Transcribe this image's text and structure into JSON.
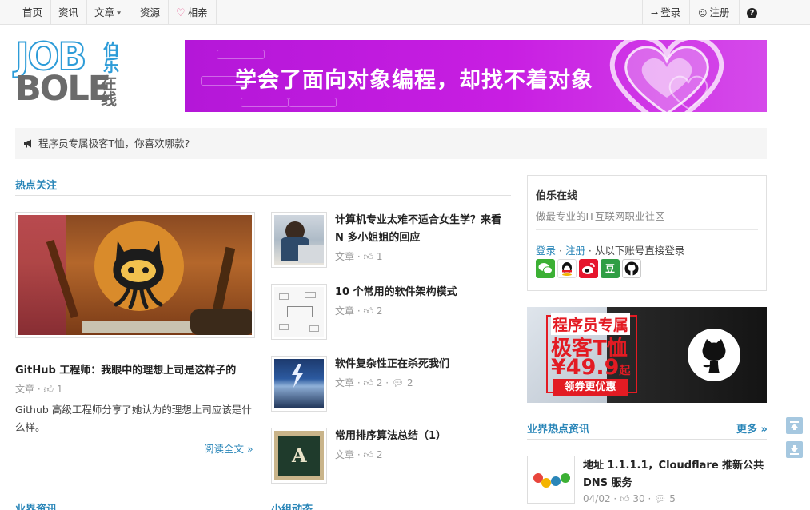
{
  "nav": {
    "items": [
      {
        "label": "首页"
      },
      {
        "label": "资讯"
      },
      {
        "label": "文章"
      },
      {
        "label": "资源"
      },
      {
        "label": "相亲"
      }
    ],
    "login": "登录",
    "register": "注册"
  },
  "logo": {
    "line1": "JOB",
    "line2": "BOLE",
    "cn1": "伯乐",
    "cn2": "在线"
  },
  "banner": {
    "text": "学会了面向对象编程，却找不着对象"
  },
  "notice": {
    "text": "程序员专属极客T恤，你喜欢哪款?"
  },
  "hot": {
    "title": "热点关注",
    "feature": {
      "title": "GitHub 工程师：我眼中的理想上司是这样子的",
      "meta": "文章 · ",
      "likes": "1",
      "desc": "Github 高级工程师分享了她认为的理想上司应该是什么样。",
      "read_more": "阅读全文 »"
    },
    "articles": [
      {
        "title": "计算机专业太难不适合女生学？来看 N 多小姐姐的回应",
        "meta": "文章 · ",
        "likes": "1",
        "comments": ""
      },
      {
        "title": "10 个常用的软件架构模式",
        "meta": "文章 · ",
        "likes": "2",
        "comments": ""
      },
      {
        "title": "软件复杂性正在杀死我们",
        "meta": "文章 · ",
        "likes": "2",
        "comments": "2"
      },
      {
        "title": "常用排序算法总结（1）",
        "meta": "文章 · ",
        "likes": "2",
        "comments": ""
      }
    ]
  },
  "sections": {
    "industry": "业界资讯",
    "group": "小组动态"
  },
  "sidebar": {
    "title": "伯乐在线",
    "subtitle": "做最专业的IT互联网职业社区",
    "login": "登录",
    "register": "注册",
    "login_sep": " · ",
    "login_suffix": " · 从以下账号直接登录"
  },
  "ad2": {
    "line1": "程序员专属",
    "line2": "极客T恤",
    "price": "¥49.9",
    "price_suffix": "起",
    "button": "领券更优惠"
  },
  "hot_news": {
    "title": "业界热点资讯",
    "more": "更多 »",
    "items": [
      {
        "title": "地址 1.1.1.1，Cloudflare 推新公共 DNS 服务",
        "date": "04/02",
        "likes": "30",
        "comments": "5"
      }
    ]
  },
  "colors": {
    "accent": "#2a86b8",
    "banner": "#c81ee2",
    "ad_red": "#e31b23"
  }
}
